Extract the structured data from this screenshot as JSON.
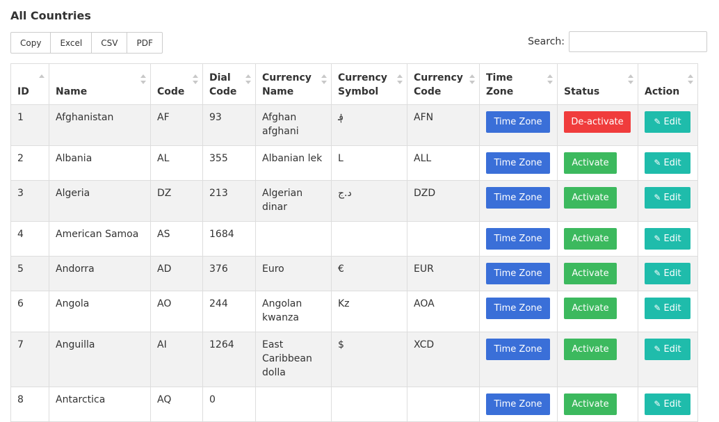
{
  "page": {
    "title": "All Countries"
  },
  "export_buttons": [
    "Copy",
    "Excel",
    "CSV",
    "PDF"
  ],
  "search": {
    "label": "Search:",
    "value": "",
    "placeholder": ""
  },
  "columns": [
    "ID",
    "Name",
    "Code",
    "Dial\nCode",
    "Currency\nName",
    "Currency\nSymbol",
    "Currency\nCode",
    "Time Zone",
    "Status",
    "Action"
  ],
  "rows": [
    {
      "id": "1",
      "name": "Afghanistan",
      "code": "AF",
      "dial": "93",
      "currency_name": "Afghan\nafghani",
      "symbol": "؋",
      "currency_code": "AFN",
      "timezone_label": "Time Zone",
      "status_label": "De-activate",
      "status_type": "deactivate",
      "edit_label": "Edit"
    },
    {
      "id": "2",
      "name": "Albania",
      "code": "AL",
      "dial": "355",
      "currency_name": "Albanian lek",
      "symbol": "L",
      "currency_code": "ALL",
      "timezone_label": "Time Zone",
      "status_label": "Activate",
      "status_type": "activate",
      "edit_label": "Edit"
    },
    {
      "id": "3",
      "name": "Algeria",
      "code": "DZ",
      "dial": "213",
      "currency_name": "Algerian\ndinar",
      "symbol": "د.ج",
      "currency_code": "DZD",
      "timezone_label": "Time Zone",
      "status_label": "Activate",
      "status_type": "activate",
      "edit_label": "Edit"
    },
    {
      "id": "4",
      "name": "American Samoa",
      "code": "AS",
      "dial": "1684",
      "currency_name": "",
      "symbol": "",
      "currency_code": "",
      "timezone_label": "Time Zone",
      "status_label": "Activate",
      "status_type": "activate",
      "edit_label": "Edit"
    },
    {
      "id": "5",
      "name": "Andorra",
      "code": "AD",
      "dial": "376",
      "currency_name": "Euro",
      "symbol": "€",
      "currency_code": "EUR",
      "timezone_label": "Time Zone",
      "status_label": "Activate",
      "status_type": "activate",
      "edit_label": "Edit"
    },
    {
      "id": "6",
      "name": "Angola",
      "code": "AO",
      "dial": "244",
      "currency_name": "Angolan\nkwanza",
      "symbol": "Kz",
      "currency_code": "AOA",
      "timezone_label": "Time Zone",
      "status_label": "Activate",
      "status_type": "activate",
      "edit_label": "Edit"
    },
    {
      "id": "7",
      "name": "Anguilla",
      "code": "AI",
      "dial": "1264",
      "currency_name": "East\nCaribbean\ndolla",
      "symbol": "$",
      "currency_code": "XCD",
      "timezone_label": "Time Zone",
      "status_label": "Activate",
      "status_type": "activate",
      "edit_label": "Edit"
    },
    {
      "id": "8",
      "name": "Antarctica",
      "code": "AQ",
      "dial": "0",
      "currency_name": "",
      "symbol": "",
      "currency_code": "",
      "timezone_label": "Time Zone",
      "status_label": "Activate",
      "status_type": "activate",
      "edit_label": "Edit"
    }
  ],
  "colors": {
    "timezone": "#3a6fd8",
    "activate": "#3cb95e",
    "deactivate": "#f03c3c",
    "edit": "#1fbcab"
  }
}
